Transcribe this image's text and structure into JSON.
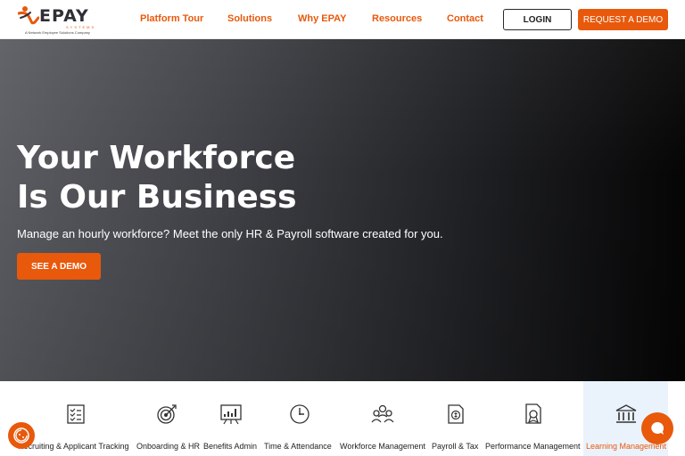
{
  "brand": {
    "name": "EPAY",
    "tagline_line1": "SYSTEMS",
    "tagline_line2": "A Network Employee Solutions Company",
    "accent": "#e8590c",
    "logo_icon": "runner-swoosh-icon"
  },
  "nav": {
    "items": [
      {
        "label": "Platform Tour"
      },
      {
        "label": "Solutions"
      },
      {
        "label": "Why EPAY"
      },
      {
        "label": "Resources"
      },
      {
        "label": "Contact"
      }
    ],
    "login_label": "LOGIN",
    "demo_label": "REQUEST A DEMO"
  },
  "hero": {
    "title_line1": "Your Workforce",
    "title_line2": "Is Our Business",
    "subtitle": "Manage an hourly workforce? Meet the only HR & Payroll software created for you.",
    "cta_label": "SEE A DEMO"
  },
  "features": [
    {
      "label": "Recruiting & Applicant Tracking",
      "icon": "checklist-icon"
    },
    {
      "label": "Onboarding & HR",
      "icon": "target-icon"
    },
    {
      "label": "Benefits Admin",
      "icon": "chart-board-icon"
    },
    {
      "label": "Time & Attendance",
      "icon": "clock-icon"
    },
    {
      "label": "Workforce Management",
      "icon": "people-group-icon"
    },
    {
      "label": "Payroll & Tax",
      "icon": "payroll-document-icon"
    },
    {
      "label": "Performance Management",
      "icon": "certificate-icon"
    },
    {
      "label": "Learning Management",
      "icon": "institution-icon",
      "active": true
    }
  ],
  "widgets": {
    "cookie_icon": "cookie-settings-icon",
    "chat_icon": "chat-bubble-icon"
  }
}
